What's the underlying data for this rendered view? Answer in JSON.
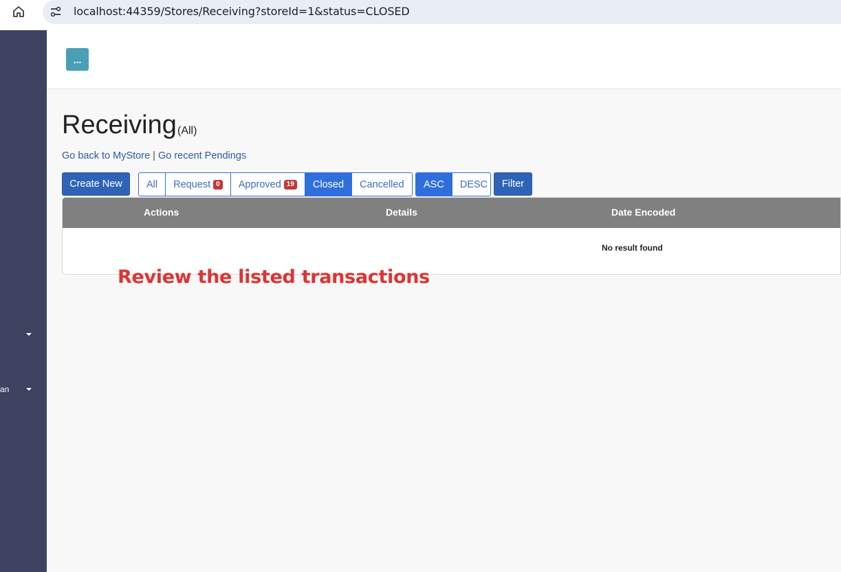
{
  "browser": {
    "url": "localhost:44359/Stores/Receiving?storeId=1&status=CLOSED",
    "home_icon": "home-icon",
    "site_info_icon": "site-settings-icon"
  },
  "sidebar": {
    "background": "#3d4360",
    "items": [
      {
        "label": "",
        "icon": "caret-down-icon"
      },
      {
        "label": "an",
        "icon": "caret-down-icon"
      }
    ]
  },
  "header": {
    "menu_button_label": "...",
    "menu_button_color": "#4a9fb5"
  },
  "page": {
    "title": "Receiving",
    "subtitle": "(All)",
    "links": {
      "back": "Go back to MyStore",
      "separator": "|",
      "recent": "Go recent Pendings"
    }
  },
  "toolbar": {
    "create_new": "Create New",
    "status_filters": [
      {
        "label": "All",
        "active": false
      },
      {
        "label": "Request",
        "badge": "0",
        "active": false
      },
      {
        "label": "Approved",
        "badge": "19",
        "active": false
      },
      {
        "label": "Closed",
        "active": true
      },
      {
        "label": "Cancelled",
        "active": false
      }
    ],
    "sort": [
      {
        "label": "ASC",
        "active": true
      },
      {
        "label": "DESC",
        "active": false
      }
    ],
    "filter": "Filter"
  },
  "table": {
    "columns": [
      "Actions",
      "Details",
      "Date Encoded"
    ],
    "empty_message": "No result found"
  },
  "annotation": {
    "text": "Review the listed transactions",
    "color": "#e03333"
  }
}
